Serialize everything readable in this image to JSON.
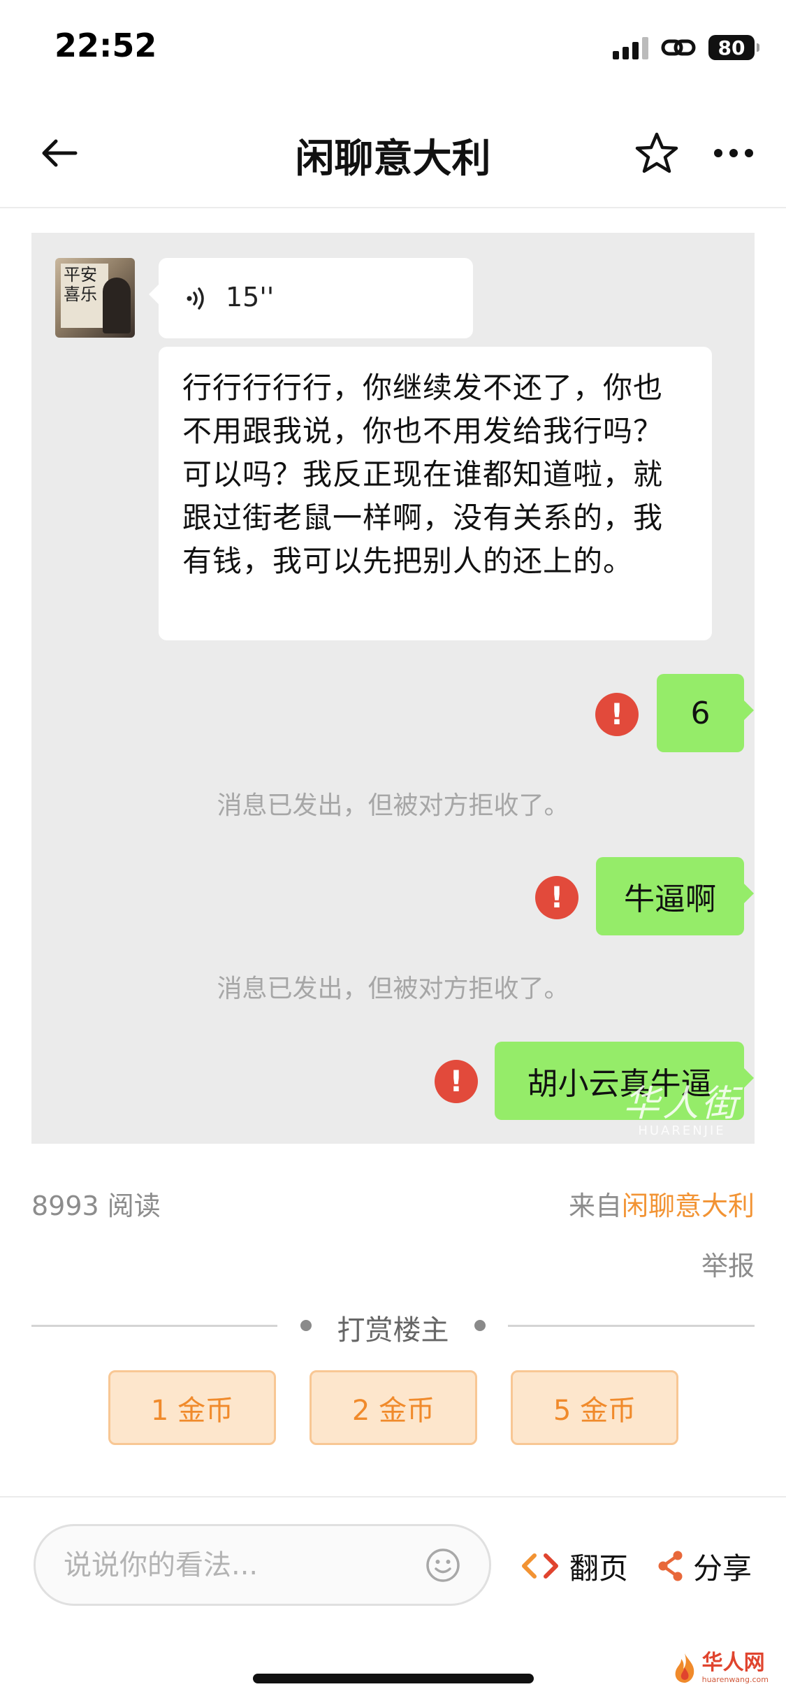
{
  "status_bar": {
    "time": "22:52",
    "battery": "80"
  },
  "nav": {
    "title": "闲聊意大利"
  },
  "chat": {
    "voice": {
      "duration": "15''"
    },
    "incoming_text": "行行行行行，你继续发不还了，你也不用跟我说，你也不用发给我行吗？可以吗？我反正现在谁都知道啦，就跟过街老鼠一样啊，没有关系的，我有钱，我可以先把别人的还上的。",
    "outgoing": [
      {
        "text": "6"
      },
      {
        "text": "牛逼啊"
      },
      {
        "text": "胡小云真牛逼"
      }
    ],
    "error_mark": "!",
    "rejected_notice": "消息已发出，但被对方拒收了。",
    "watermark_cn": "华人街",
    "watermark_en": "HUARENJIE"
  },
  "meta": {
    "reads": "8993 阅读",
    "source_prefix": "来自",
    "source_name": "闲聊意大利",
    "report": "举报"
  },
  "reward": {
    "title": "打赏楼主",
    "options": [
      "1 金币",
      "2 金币",
      "5 金币"
    ]
  },
  "bottom_bar": {
    "comment_placeholder": "说说你的看法...",
    "page_label": "翻页",
    "share_label": "分享"
  },
  "site_logo": {
    "name": "华人网",
    "url": "huarenwang.com"
  },
  "colors": {
    "accent_orange": "#f29333",
    "bubble_green": "#95ec69",
    "error_red": "#e24a3b",
    "reward_bg": "#fde6cc"
  },
  "icons": [
    "back-arrow-icon",
    "star-icon",
    "more-icon",
    "voice-wave-icon",
    "error-icon",
    "emoji-icon",
    "code-arrows-icon",
    "share-icon",
    "flame-logo-icon"
  ]
}
